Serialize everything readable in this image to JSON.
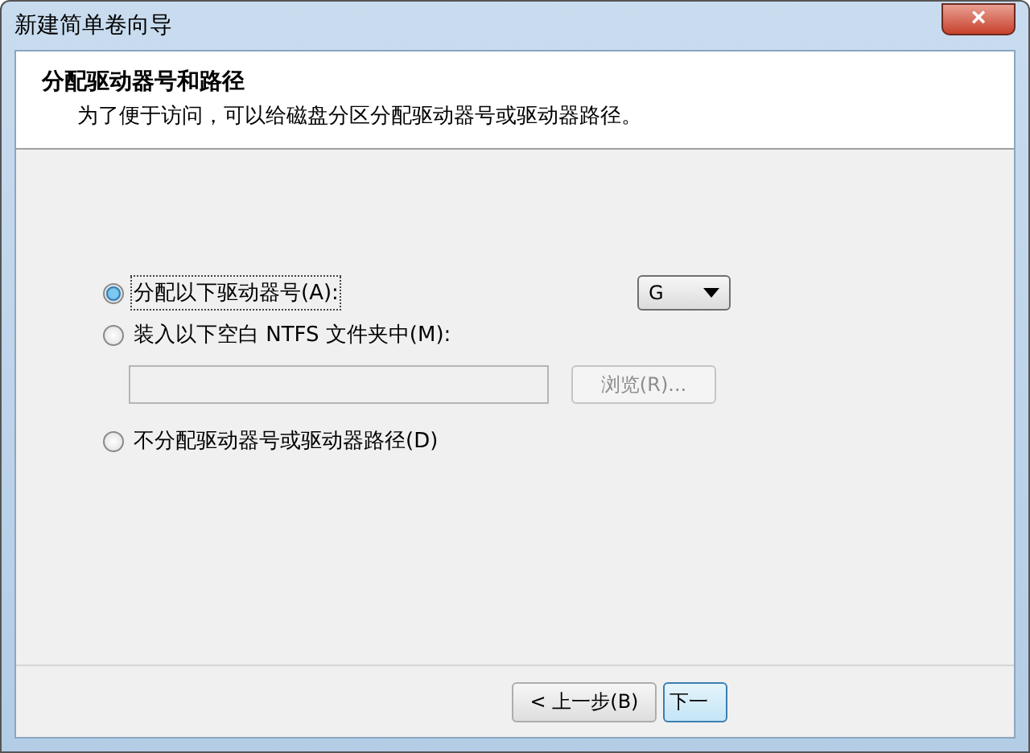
{
  "window": {
    "title": "新建简单卷向导",
    "close": "×"
  },
  "header": {
    "title": "分配驱动器号和路径",
    "subtitle": "为了便于访问，可以给磁盘分区分配驱动器号或驱动器路径。"
  },
  "options": [
    {
      "kind": "letter",
      "label": "分配以下驱动器号(A):",
      "selected": true,
      "value": "G"
    },
    {
      "kind": "folder",
      "label": "装入以下空白 NTFS 文件夹中(M):",
      "selected": false,
      "browse": "浏览(R)...",
      "disabled": true
    },
    {
      "kind": "none",
      "label": "不分配驱动器号或驱动器路径(D)",
      "selected": false
    }
  ],
  "buttons": [
    {
      "label": "< 上一步(B)"
    },
    {
      "label": "下一"
    }
  ]
}
